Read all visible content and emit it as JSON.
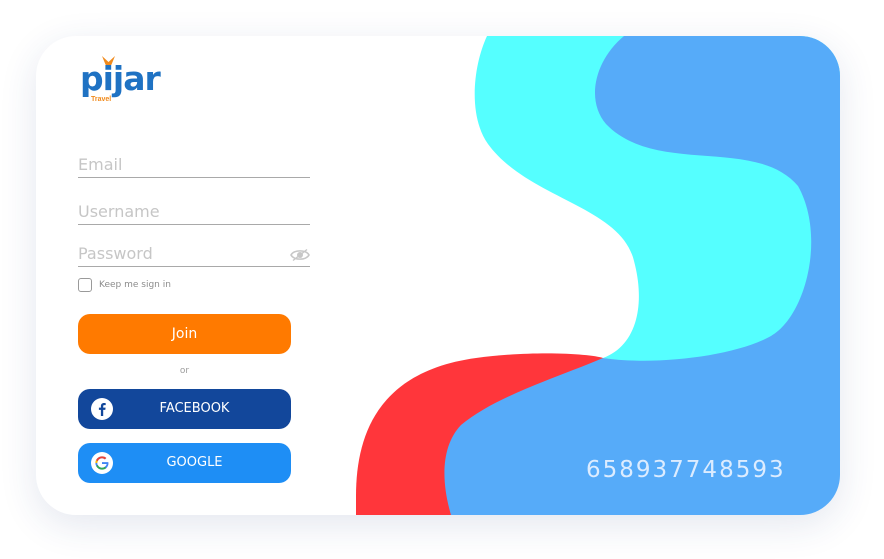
{
  "brand": {
    "name": "pijar",
    "tagline": "Travel",
    "colors": {
      "primary": "#1f72c3",
      "accent": "#f08a1c"
    }
  },
  "form": {
    "email_placeholder": "Email",
    "username_placeholder": "Username",
    "password_placeholder": "Password",
    "password_toggle_icon": "eye-icon",
    "keep_signed_in_label": "Keep me sign in",
    "keep_signed_in_checked": false
  },
  "actions": {
    "join_label": "Join",
    "or_label": "or",
    "facebook_label": "FACEBOOK",
    "google_label": "GOOGLE"
  },
  "decor": {
    "code_text": "658937748593",
    "colors": {
      "cyan": "#55ffff",
      "blue": "#56abf9",
      "red": "#ff363b",
      "join": "#ff7a00",
      "facebook": "#12479b",
      "google": "#1e8ef5"
    }
  }
}
